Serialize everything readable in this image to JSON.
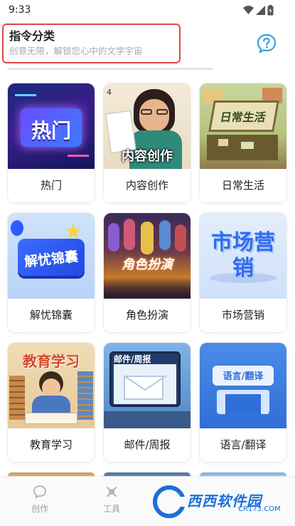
{
  "status_bar": {
    "time": "9:33"
  },
  "header": {
    "title": "指令分类",
    "subtitle": "创意无限，解锁您心中的文学宇宙",
    "help_icon": "question-icon"
  },
  "categories": [
    {
      "label": "热门",
      "image_text": "热门"
    },
    {
      "label": "内容创作",
      "image_text": "内容创作"
    },
    {
      "label": "日常生活",
      "image_text": "日常生活"
    },
    {
      "label": "解忧锦囊",
      "image_text": "解忧锦囊"
    },
    {
      "label": "角色扮演",
      "image_text": "角色扮演"
    },
    {
      "label": "市场营销",
      "image_text": "市场营销"
    },
    {
      "label": "教育学习",
      "image_text": "教育学习"
    },
    {
      "label": "邮件/周报",
      "image_text": "邮件/周报"
    },
    {
      "label": "语言/翻译",
      "image_text": "语言/翻译"
    }
  ],
  "bottom_nav": {
    "items": [
      {
        "label": "创作",
        "icon": "chat-bubble-icon"
      },
      {
        "label": "工具",
        "icon": "tools-icon"
      }
    ],
    "watermark": {
      "text": "西西软件园",
      "sub": "CR173.COM"
    }
  },
  "colors": {
    "highlight_border": "#e04848",
    "accent_blue": "#1c6fd8",
    "help_icon": "#3aa0d8"
  }
}
